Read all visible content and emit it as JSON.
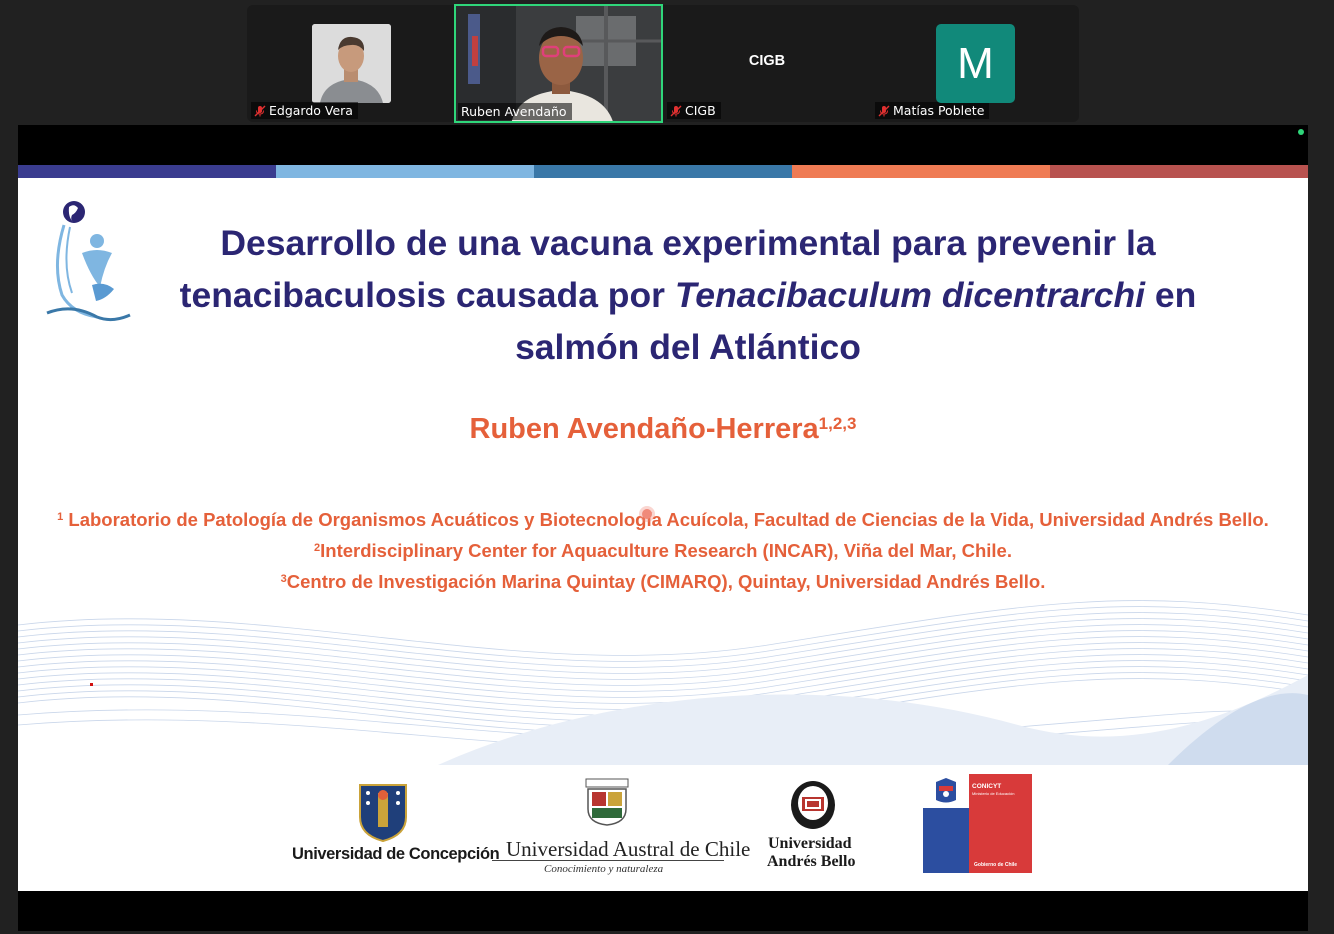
{
  "participants": [
    {
      "name": "Edgardo Vera",
      "mic": "muted",
      "video": "on"
    },
    {
      "name": "Ruben Avendaño",
      "mic": "unmuted",
      "video": "on",
      "speaking": true
    },
    {
      "name": "CIGB",
      "mic": "muted",
      "video": "off",
      "display_label": "CIGB"
    },
    {
      "name": "Matías Poblete",
      "mic": "muted",
      "video": "off",
      "avatar_letter": "M"
    }
  ],
  "slide": {
    "title_line1": "Desarrollo de una vacuna experimental para prevenir la",
    "title_line2_pre": "tenacibaculosis causada por ",
    "title_line2_italic": "Tenacibaculum dicentrarchi",
    "title_line2_post": " en",
    "title_line3": "salmón del Atlántico",
    "author": "Ruben Avendaño-Herrera",
    "author_sup": "1,2,3",
    "affiliations": [
      {
        "sup": "1",
        "text": " Laboratorio de Patología de Organismos Acuáticos y Biotecnología Acuícola, Facultad de Ciencias de la Vida, Universidad Andrés Bello."
      },
      {
        "sup": "2",
        "text": "Interdisciplinary Center for Aquaculture Research (INCAR), Viña del Mar, Chile."
      },
      {
        "sup": "3",
        "text": "Centro de Investigación Marina Quintay (CIMARQ), Quintay, Universidad Andrés Bello."
      }
    ],
    "colorbar": [
      "#3a3c8f",
      "#7fb6e1",
      "#3a78a8",
      "#ef7b54",
      "#b8524f"
    ],
    "logos": {
      "udec": "Universidad de Concepción",
      "uach": "Universidad Austral de Chile",
      "uach_tagline": "Conocimiento y naturaleza",
      "unab_line1": "Universidad",
      "unab_line2": "Andrés Bello",
      "conicyt": "CONICYT",
      "conicyt_sub": "Ministerio de Educación",
      "gobierno": "Gobierno de Chile"
    }
  },
  "colors": {
    "title": "#2b2673",
    "accent": "#e5603a",
    "speaker_border": "#2fd67a",
    "avatar_bg": "#11897a"
  }
}
